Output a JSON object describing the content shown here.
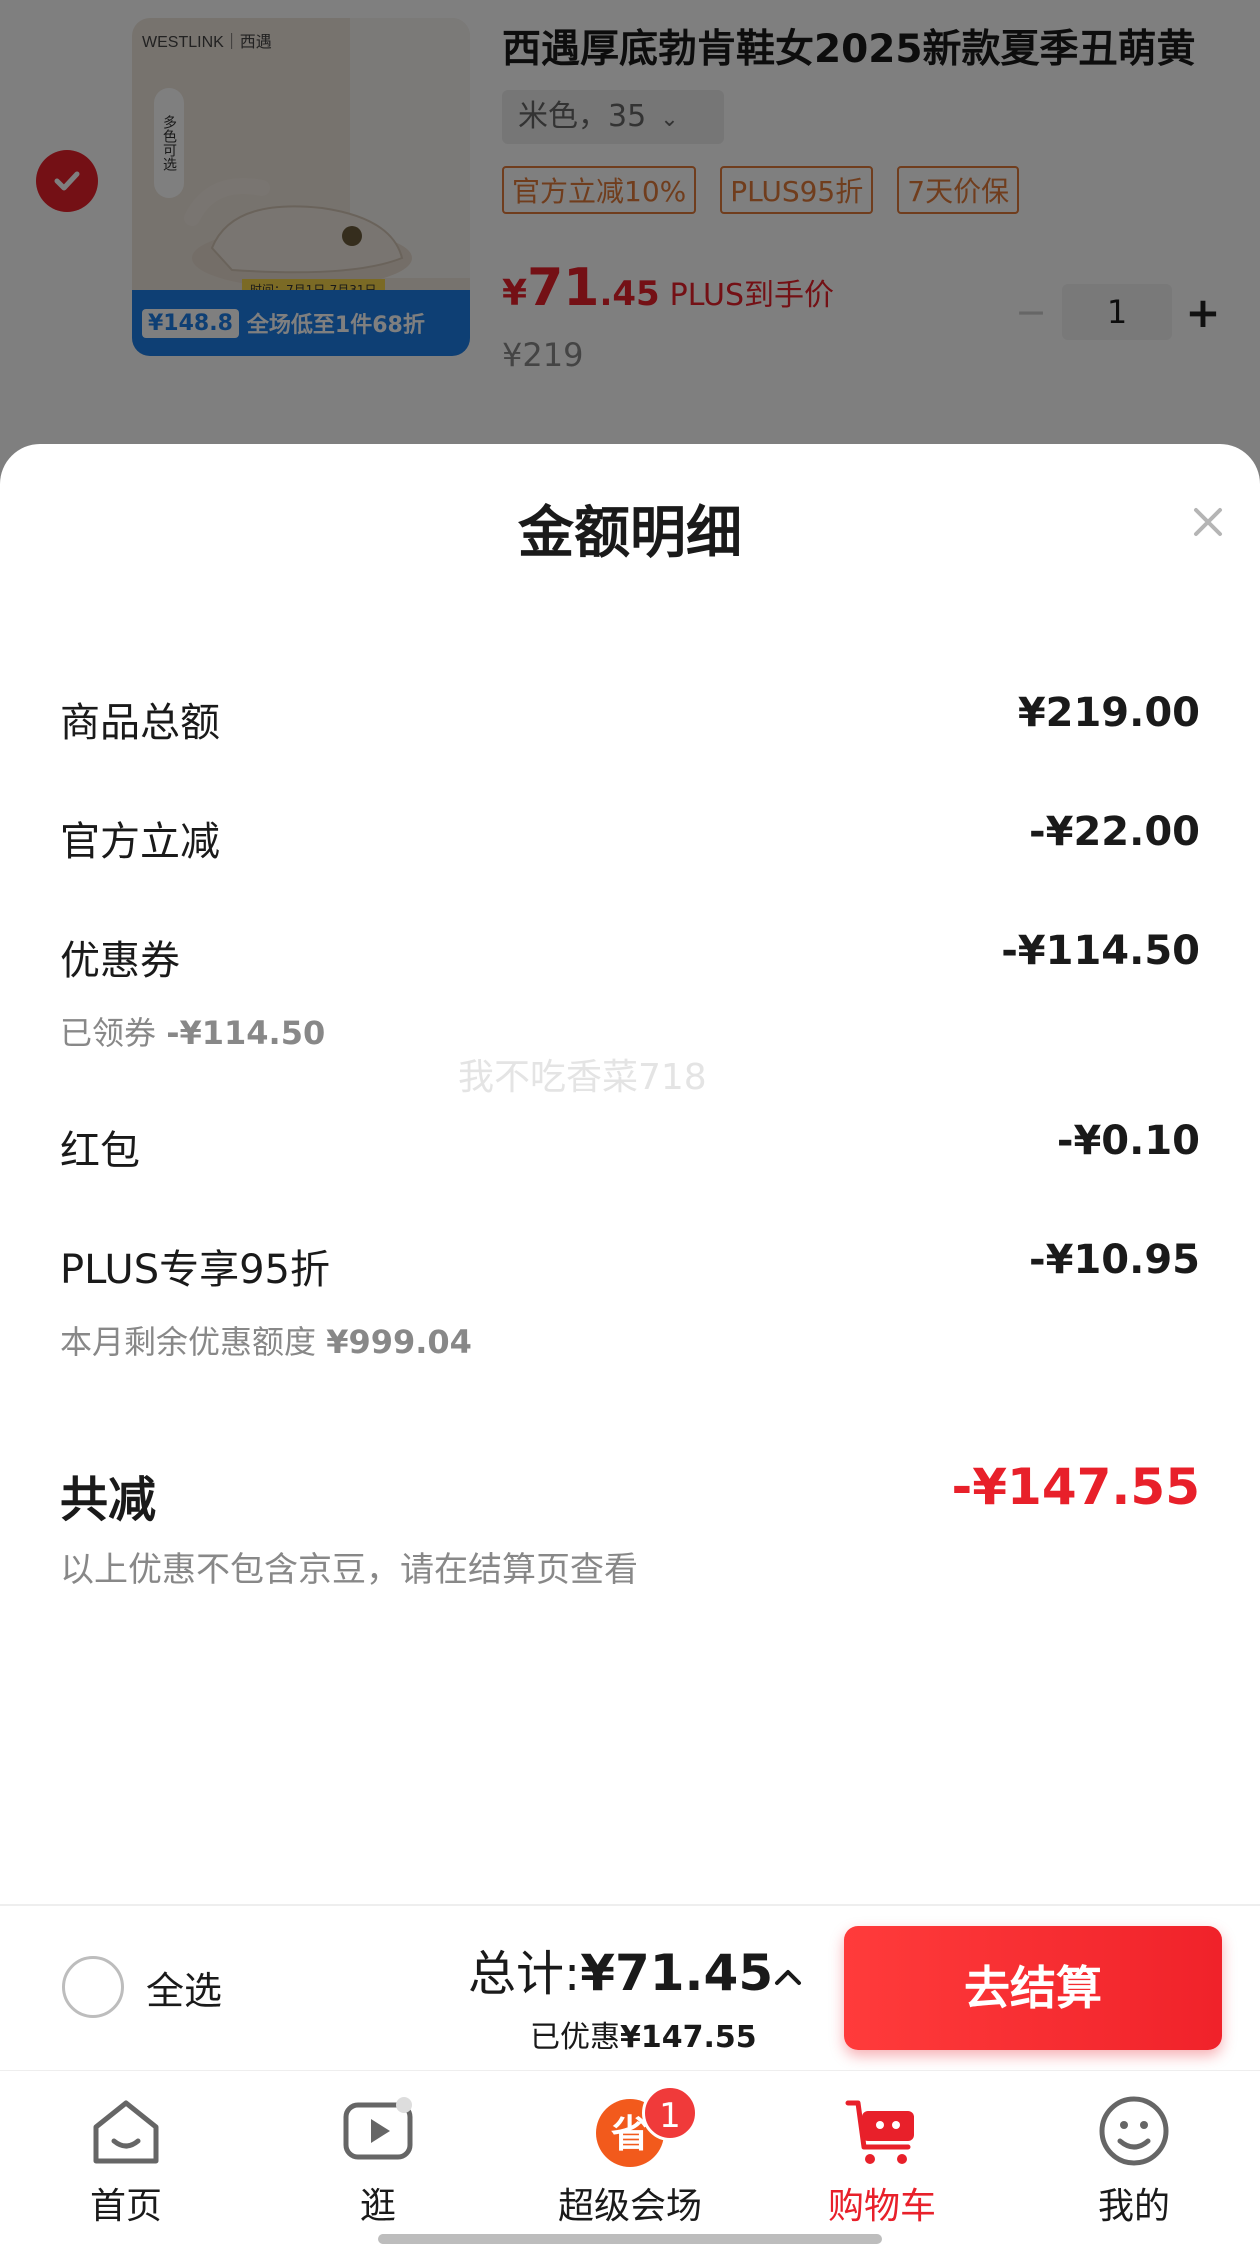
{
  "product": {
    "title": "西遇厚底勃肯鞋女2025新款夏季丑萌黄",
    "spec": "米色，35",
    "tags": [
      "官方立减10%",
      "PLUS95折",
      "7天价保"
    ],
    "price_yen": "¥",
    "price_int": "71",
    "price_dec": ".45",
    "price_label": "PLUS到手价",
    "original_price": "¥219",
    "quantity": "1",
    "image": {
      "brand": "WESTLINK｜西遇",
      "multi_color": "多色可选",
      "member_price": "¥148.8",
      "promo_text": "全场低至1件68折",
      "promo_time": "时间：7月1日-7月31日"
    },
    "checked": true
  },
  "sheet": {
    "title": "金额明细",
    "rows": [
      {
        "label": "商品总额",
        "value": "¥219.00"
      },
      {
        "label": "官方立减",
        "value": "-¥22.00"
      },
      {
        "label": "优惠券",
        "value": "-¥114.50",
        "sub_label": "已领券",
        "sub_value": "-¥114.50"
      },
      {
        "label": "红包",
        "value": "-¥0.10"
      },
      {
        "label": "PLUS专享95折",
        "value": "-¥10.95",
        "sub_label": "本月剩余优惠额度",
        "sub_value": "¥999.04"
      }
    ],
    "watermark": "我不吃香菜718",
    "total_label": "共减",
    "total_value": "-¥147.55",
    "total_note": "以上优惠不包含京豆，请在结算页查看"
  },
  "checkout": {
    "select_all_label": "全选",
    "total_label": "总计:",
    "total_amount": "¥71.45",
    "saved_label": "已优惠",
    "saved_amount": "¥147.55",
    "pay_button": "去结算"
  },
  "tabs": [
    {
      "label": "首页",
      "icon": "home-icon"
    },
    {
      "label": "逛",
      "icon": "play-icon"
    },
    {
      "label": "超级会场",
      "icon": "super-venue-icon",
      "badge": "1"
    },
    {
      "label": "购物车",
      "icon": "cart-icon",
      "active": true
    },
    {
      "label": "我的",
      "icon": "profile-icon"
    }
  ],
  "colors": {
    "accent": "#e8202a",
    "tag_orange": "#e07a3a",
    "muted": "#888888"
  }
}
